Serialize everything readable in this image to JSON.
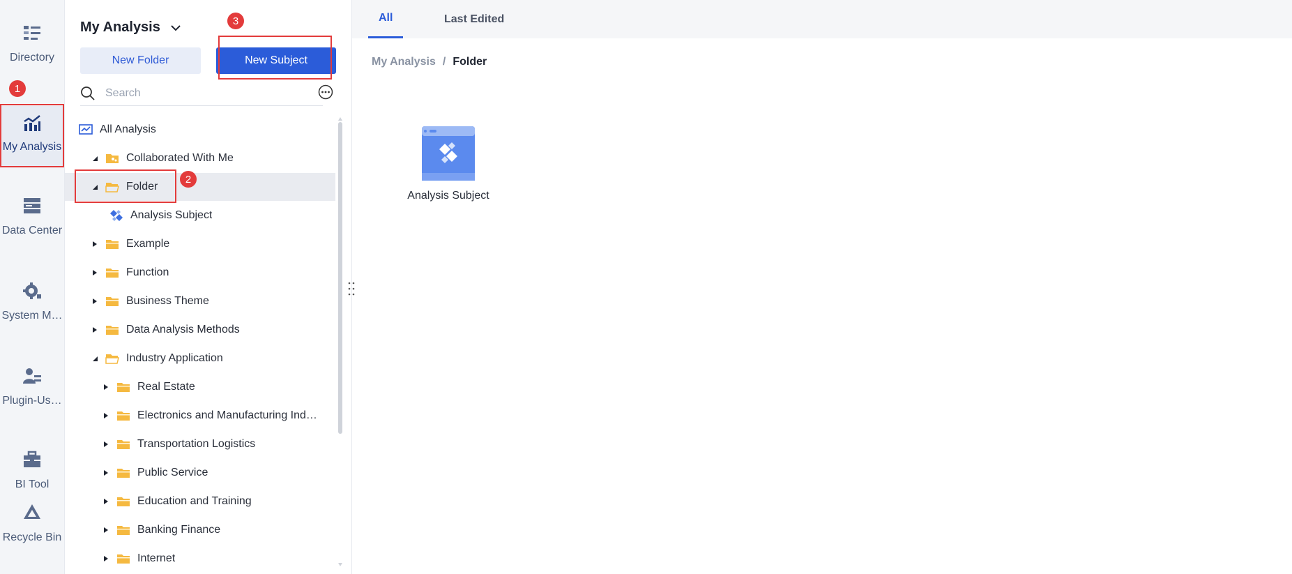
{
  "rail": {
    "items": [
      {
        "label": "Directory",
        "icon": "directory-icon"
      },
      {
        "label": "My Analysis",
        "icon": "analysis-chart-icon"
      },
      {
        "label": "Data Center",
        "icon": "data-center-icon"
      },
      {
        "label": "System M…",
        "icon": "system-gear-icon"
      },
      {
        "label": "Plugin-Us…",
        "icon": "plugin-user-icon"
      },
      {
        "label": "BI Tool",
        "icon": "toolbox-icon"
      },
      {
        "label": "Recycle Bin",
        "icon": "recycle-icon"
      }
    ]
  },
  "panel": {
    "title": "My Analysis",
    "new_folder": "New Folder",
    "new_subject": "New Subject",
    "search_placeholder": "Search",
    "tree": [
      {
        "label": "All Analysis",
        "type": "root"
      },
      {
        "label": "Collaborated With Me",
        "type": "shared-folder",
        "expanded": true
      },
      {
        "label": "Folder",
        "type": "folder-open",
        "expanded": true,
        "selected": true
      },
      {
        "label": "Analysis Subject",
        "type": "subject"
      },
      {
        "label": "Example",
        "type": "folder"
      },
      {
        "label": "Function",
        "type": "folder"
      },
      {
        "label": "Business Theme",
        "type": "folder"
      },
      {
        "label": "Data Analysis Methods",
        "type": "folder"
      },
      {
        "label": "Industry Application",
        "type": "folder-open",
        "expanded": true
      },
      {
        "label": "Real Estate",
        "type": "folder"
      },
      {
        "label": "Electronics and Manufacturing Ind…",
        "type": "folder"
      },
      {
        "label": "Transportation Logistics",
        "type": "folder"
      },
      {
        "label": "Public Service",
        "type": "folder"
      },
      {
        "label": "Education and Training",
        "type": "folder"
      },
      {
        "label": "Banking Finance",
        "type": "folder"
      },
      {
        "label": "Internet",
        "type": "folder"
      }
    ]
  },
  "main": {
    "tabs": [
      "All",
      "Last Edited"
    ],
    "breadcrumb": {
      "root": "My Analysis",
      "sep": "/",
      "current": "Folder"
    },
    "items": [
      {
        "label": "Analysis Subject",
        "icon": "analysis-subject-icon"
      }
    ]
  },
  "annotations": [
    "1",
    "2",
    "3"
  ],
  "colors": {
    "accent": "#2b5cd9",
    "highlight": "#e33b3b",
    "folder": "#f5b940"
  }
}
